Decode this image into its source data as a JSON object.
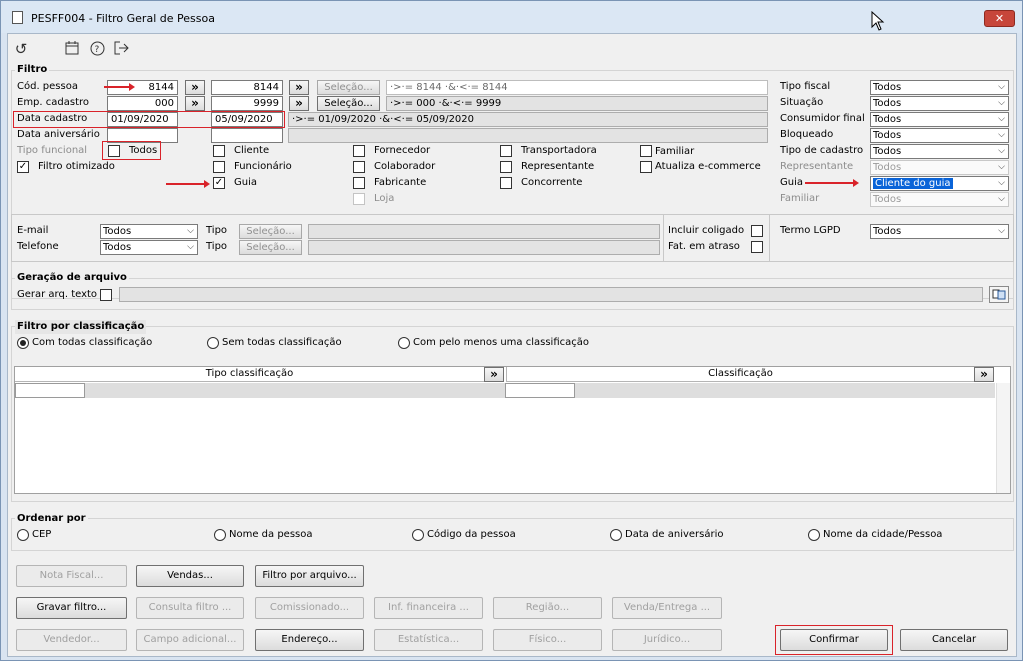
{
  "window": {
    "title": "PESFF004 - Filtro Geral de Pessoa",
    "close_glyph": "✕"
  },
  "toolbar": {
    "icons": [
      "refresh-icon",
      "calendar-icon",
      "help-icon",
      "exit-icon"
    ]
  },
  "filtro": {
    "title": "Filtro",
    "cod_pessoa": {
      "label": "Cód. pessoa",
      "from": "8144",
      "to": "8144",
      "selecao": "Seleção...",
      "expr": "·>·= 8144 ·&·<·= 8144"
    },
    "emp_cadastro": {
      "label": "Emp. cadastro",
      "from": "000",
      "to": "9999",
      "selecao": "Seleção...",
      "expr": "·>·= 000 ·&·<·= 9999"
    },
    "data_cadastro": {
      "label": "Data cadastro",
      "from": "01/09/2020",
      "to": "05/09/2020",
      "expr": "·>·= 01/09/2020 ·&·<·= 05/09/2020"
    },
    "data_aniversario": {
      "label": "Data aniversário"
    },
    "tipo_funcional": {
      "label": "Tipo funcional",
      "todos": "Todos"
    },
    "filtro_otimizado": "Filtro otimizado",
    "checks": {
      "cliente": "Cliente",
      "funcionario": "Funcionário",
      "guia": "Guia",
      "fornecedor": "Fornecedor",
      "colaborador": "Colaborador",
      "fabricante": "Fabricante",
      "loja": "Loja",
      "transportadora": "Transportadora",
      "representante": "Representante",
      "concorrente": "Concorrente",
      "familiar": "Familiar",
      "atualiza_ecommerce": "Atualiza e-commerce"
    },
    "right": [
      {
        "label": "Tipo fiscal",
        "value": "Todos"
      },
      {
        "label": "Situação",
        "value": "Todos"
      },
      {
        "label": "Consumidor final",
        "value": "Todos"
      },
      {
        "label": "Bloqueado",
        "value": "Todos"
      },
      {
        "label": "Tipo de cadastro",
        "value": "Todos"
      },
      {
        "label": "Representante",
        "value": "Todos"
      },
      {
        "label": "Guia",
        "value": "Cliente do guia"
      },
      {
        "label": "Familiar",
        "value": "Todos"
      }
    ],
    "contato": {
      "email_label": "E-mail",
      "email_value": "Todos",
      "telefone_label": "Telefone",
      "telefone_value": "Todos",
      "tipo_label": "Tipo",
      "selecao": "Seleção...",
      "incluir_coligado": "Incluir coligado",
      "fat_atraso": "Fat. em atraso",
      "termo_lgpd_label": "Termo LGPD",
      "termo_lgpd_value": "Todos"
    }
  },
  "geracao": {
    "title": "Geração de arquivo",
    "gerar_label": "Gerar arq. texto"
  },
  "classificacao": {
    "title": "Filtro por classificação",
    "options": [
      "Com todas classificação",
      "Sem todas classificação",
      "Com pelo menos uma classificação"
    ],
    "col_tipo": "Tipo classificação",
    "col_class": "Classificação",
    "expand": "»"
  },
  "ordenar": {
    "title": "Ordenar por",
    "options": [
      "CEP",
      "Nome da pessoa",
      "Código da pessoa",
      "Data de aniversário",
      "Nome da cidade/Pessoa"
    ]
  },
  "buttons": {
    "nota_fiscal": "Nota Fiscal...",
    "vendas": "Vendas...",
    "filtro_arquivo": "Filtro por arquivo...",
    "gravar_filtro": "Gravar filtro...",
    "consulta_filtro": "Consulta filtro ...",
    "comissionado": "Comissionado...",
    "inf_financeira": "Inf. financeira ...",
    "regiao": "Região...",
    "venda_entrega": "Venda/Entrega ...",
    "vendedor": "Vendedor...",
    "campo_adicional": "Campo adicional...",
    "endereco": "Endereço...",
    "estatistica": "Estatística...",
    "fisico": "Físico...",
    "juridico": "Jurídico...",
    "confirmar": "Confirmar",
    "cancelar": "Cancelar"
  },
  "glyphs": {
    "expand": "»",
    "check": "✓",
    "chevron": "⌵"
  }
}
